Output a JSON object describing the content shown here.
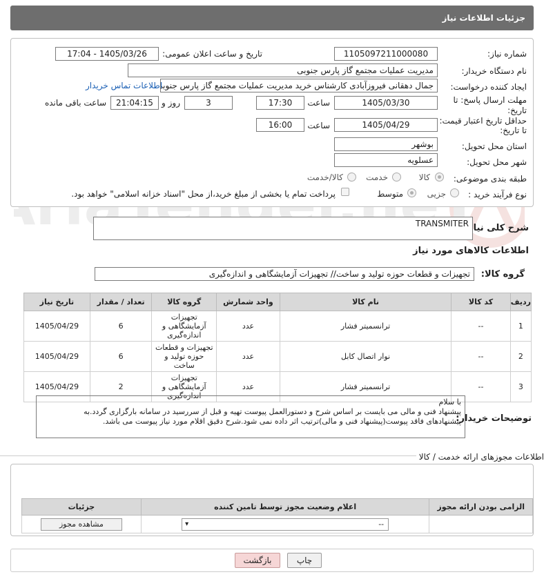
{
  "header": {
    "title": "جزئیات اطلاعات نیاز"
  },
  "form": {
    "need_number_label": "شماره نیاز:",
    "need_number": "1105097211000080",
    "announce_label": "تاریخ و ساعت اعلان عمومی:",
    "announce_value": "1405/03/26 - 17:04",
    "buyer_org_label": "نام دستگاه خریدار:",
    "buyer_org": "مدیریت عملیات مجتمع گاز پارس جنوبی",
    "requester_label": "ایجاد کننده درخواست:",
    "requester": "جمال دهقانی فیروزآبادی کارشناس خرید مدیریت عملیات مجتمع گاز پارس جنوبی",
    "contact_link": "اطلاعات تماس خریدار",
    "send_deadline_label_1": "مهلت ارسال پاسخ: تا",
    "send_deadline_label_2": "تاریخ:",
    "send_date": "1405/03/30",
    "time_label": "ساعت",
    "send_time": "17:30",
    "days_value": "3",
    "days_label": "روز و",
    "remaining_time": "21:04:15",
    "remaining_label": "ساعت باقی مانده",
    "validity_label_1": "حداقل تاریخ اعتبار قیمت:",
    "validity_label_2": "تا تاریخ:",
    "validity_date": "1405/04/29",
    "validity_time": "16:00",
    "province_label": "استان محل تحویل:",
    "province": "بوشهر",
    "city_label": "شهر محل تحویل:",
    "city": "عسلویه",
    "category_label": "طبقه بندی موضوعی:",
    "category_options": [
      "کالا",
      "خدمت",
      "کالا/خدمت"
    ],
    "process_label": "نوع فرآیند خرید :",
    "process_options": [
      "جزیی",
      "متوسط"
    ],
    "payment_note": "پرداخت تمام یا بخشی از مبلغ خرید،از محل \"اسناد خزانه اسلامی\" خواهد بود."
  },
  "summary": {
    "label": "شرح کلی نیاز:",
    "value": "TRANSMITER"
  },
  "goods": {
    "section_title": "اطلاعات کالاهای مورد نیاز",
    "group_label": "گروه کالا:",
    "group_value": "تجهیزات و قطعات حوزه تولید و ساخت// تجهیزات آزمایشگاهی و اندازه‌گیری",
    "columns": [
      "ردیف",
      "کد کالا",
      "نام کالا",
      "واحد شمارش",
      "گروه کالا",
      "تعداد / مقدار",
      "تاریخ نیاز"
    ],
    "rows": [
      {
        "row": "1",
        "code": "--",
        "name": "ترانسمیتر فشار",
        "unit": "عدد",
        "group": "تجهیزات آزمایشگاهی و اندازه‌گیری",
        "qty": "6",
        "date": "1405/04/29"
      },
      {
        "row": "2",
        "code": "--",
        "name": "نوار اتصال کابل",
        "unit": "عدد",
        "group": "تجهیزات و قطعات حوزه تولید و ساخت",
        "qty": "6",
        "date": "1405/04/29"
      },
      {
        "row": "3",
        "code": "--",
        "name": "ترانسمیتر فشار",
        "unit": "عدد",
        "group": "تجهیزات آزمایشگاهی و اندازه‌گیری",
        "qty": "2",
        "date": "1405/04/29"
      }
    ]
  },
  "buyer_notes": {
    "label": "توضیحات خریدار:",
    "line1": "با سلام",
    "line2": "پیشنهاد فنی و مالی می بایست بر اساس شرح و دستورالعمل پیوست تهیه و قبل از سررسید در سامانه بارگزاری گردد.به",
    "line3": "پیشنهادهای فاقد پیوست(پیشنهاد فنی و مالی)ترتیب اثر داده نمی شود.شرح دقیق اقلام مورد نیاز پیوست می باشد."
  },
  "permits": {
    "section_title": "اطلاعات مجوزهای ارائه خدمت / کالا",
    "columns": [
      "الزامی بودن ارائه مجوز",
      "اعلام وضعیت مجوز توسط تامین کننده",
      "جزئیات"
    ],
    "status_value": "--",
    "view_button": "مشاهده مجوز"
  },
  "actions": {
    "print": "چاپ",
    "back": "بازگشت"
  },
  "colors": {
    "header_bg": "#6e6e6e",
    "link": "#1a5fb4",
    "back_btn": "#f6d6d6"
  }
}
